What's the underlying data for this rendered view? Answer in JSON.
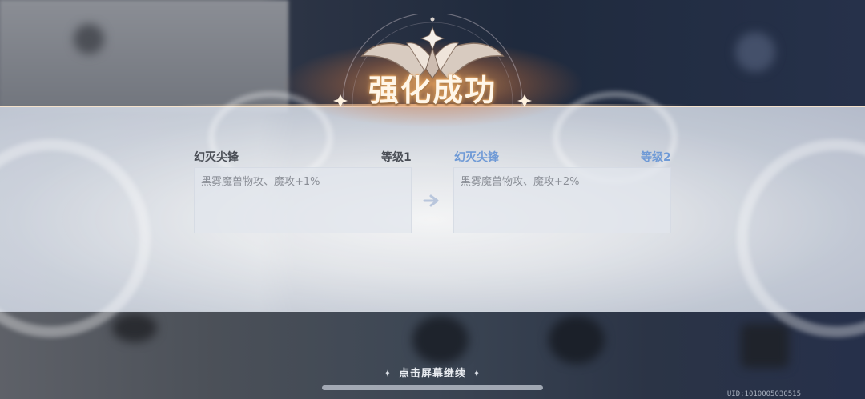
{
  "title": "强化成功",
  "before": {
    "name": "幻灭尖锋",
    "level": "等级1",
    "description": "黑雾魔兽物攻、魔攻+1%"
  },
  "after": {
    "name": "幻灭尖锋",
    "level": "等级2",
    "description": "黑雾魔兽物攻、魔攻+2%"
  },
  "continue_prompt": "点击屏幕继续",
  "uid": "UID:1010005030515",
  "colors": {
    "before_label": "#4a4e56",
    "after_label": "#6f9ad6",
    "title_glow": "#ffb86a"
  },
  "icons": {
    "arrow": "right-arrow-icon",
    "spark": "sparkle-icon"
  }
}
